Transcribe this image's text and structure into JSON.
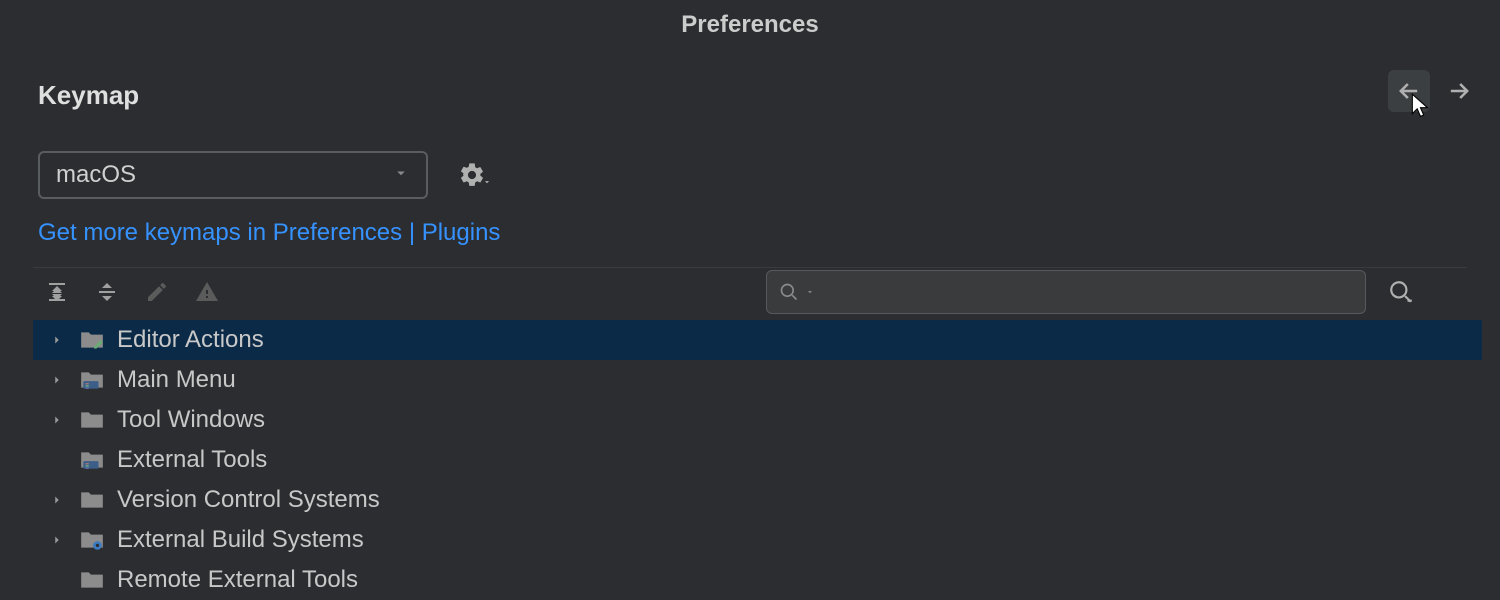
{
  "header": {
    "title": "Preferences"
  },
  "section": {
    "title": "Keymap"
  },
  "keymap": {
    "dropdown_value": "macOS",
    "link": "Get more keymaps in Preferences | Plugins"
  },
  "search": {
    "placeholder": ""
  },
  "tree": {
    "items": [
      {
        "label": "Editor Actions",
        "selected": true,
        "expandable": true,
        "icon": "folder-edit"
      },
      {
        "label": "Main Menu",
        "selected": false,
        "expandable": true,
        "icon": "folder-menu"
      },
      {
        "label": "Tool Windows",
        "selected": false,
        "expandable": true,
        "icon": "folder"
      },
      {
        "label": "External Tools",
        "selected": false,
        "expandable": false,
        "icon": "folder-menu"
      },
      {
        "label": "Version Control Systems",
        "selected": false,
        "expandable": true,
        "icon": "folder"
      },
      {
        "label": "External Build Systems",
        "selected": false,
        "expandable": true,
        "icon": "folder-gear"
      },
      {
        "label": "Remote External Tools",
        "selected": false,
        "expandable": false,
        "icon": "folder"
      }
    ]
  }
}
